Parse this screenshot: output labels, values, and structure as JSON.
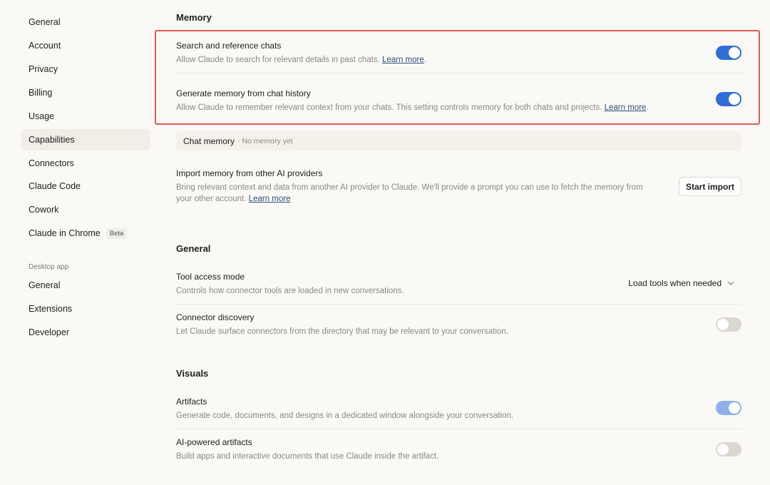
{
  "sidebar": {
    "items": [
      {
        "label": "General"
      },
      {
        "label": "Account"
      },
      {
        "label": "Privacy"
      },
      {
        "label": "Billing"
      },
      {
        "label": "Usage"
      },
      {
        "label": "Capabilities",
        "active": true
      },
      {
        "label": "Connectors"
      },
      {
        "label": "Claude Code"
      },
      {
        "label": "Cowork"
      },
      {
        "label": "Claude in Chrome",
        "badge": "Beta"
      }
    ],
    "desktop_section_label": "Desktop app",
    "desktop_items": [
      {
        "label": "General"
      },
      {
        "label": "Extensions"
      },
      {
        "label": "Developer"
      }
    ]
  },
  "memory": {
    "title": "Memory",
    "search_chats": {
      "title": "Search and reference chats",
      "desc": "Allow Claude to search for relevant details in past chats.",
      "link": "Learn more",
      "enabled": true
    },
    "generate_memory": {
      "title": "Generate memory from chat history",
      "desc": "Allow Claude to remember relevant context from your chats. This setting controls memory for both chats and projects.",
      "link": "Learn more",
      "enabled": true
    },
    "chat_memory": {
      "label": "Chat memory",
      "status": "· No memory yet"
    },
    "import": {
      "title": "Import memory from other AI providers",
      "desc": "Bring relevant context and data from another AI provider to Claude. We'll provide a prompt you can use to fetch the memory from your other account.",
      "link": "Learn more",
      "button": "Start import"
    }
  },
  "general": {
    "title": "General",
    "tool_access": {
      "title": "Tool access mode",
      "desc": "Controls how connector tools are loaded in new conversations.",
      "value": "Load tools when needed"
    },
    "connector_discovery": {
      "title": "Connector discovery",
      "desc": "Let Claude surface connectors from the directory that may be relevant to your conversation.",
      "enabled": false
    }
  },
  "visuals": {
    "title": "Visuals",
    "artifacts": {
      "title": "Artifacts",
      "desc": "Generate code, documents, and designs in a dedicated window alongside your conversation.",
      "enabled": true
    },
    "ai_artifacts": {
      "title": "AI-powered artifacts",
      "desc": "Build apps and interactive documents that use Claude inside the artifact.",
      "enabled": false
    }
  },
  "colors": {
    "toggle_on": "#2f6ed6",
    "toggle_off": "#d9d7d0",
    "highlight": "#e05a5a",
    "link": "#2c4f7c"
  },
  "icons": {
    "dropdown": "chevron-down-icon"
  }
}
